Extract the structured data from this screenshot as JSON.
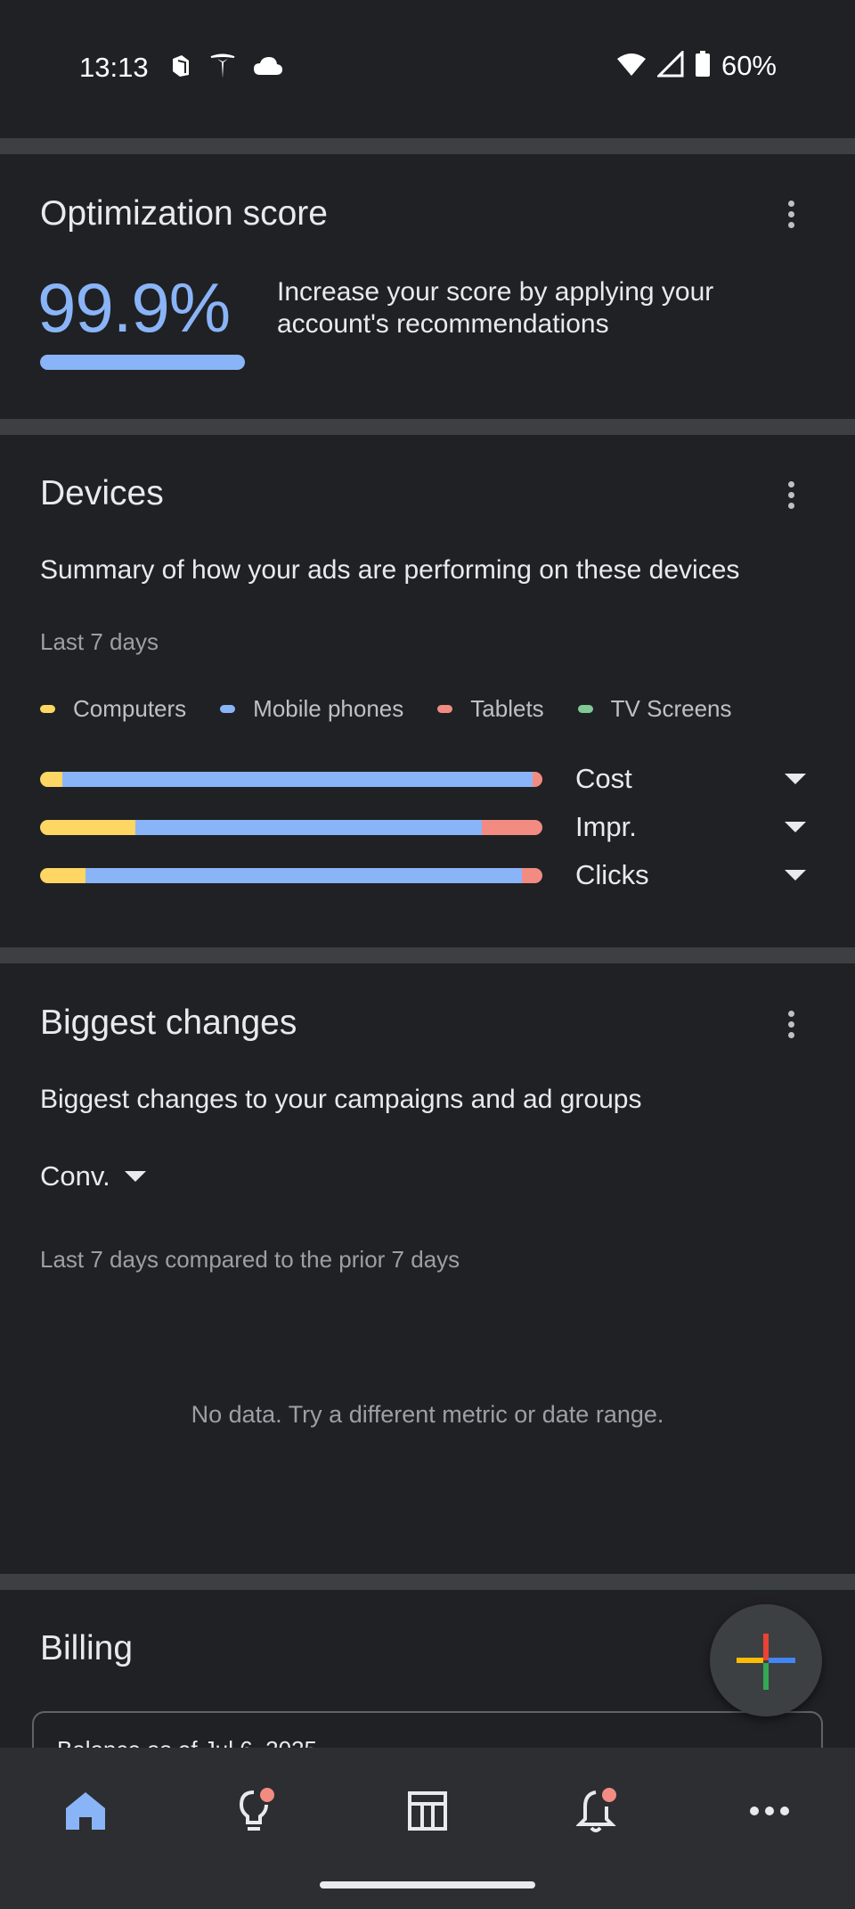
{
  "status_bar": {
    "time": "13:13",
    "battery_pct": "60%",
    "icons": [
      "notification-icon",
      "tesla-icon",
      "cloud-icon",
      "wifi-icon",
      "signal-icon",
      "battery-icon"
    ]
  },
  "optimization": {
    "title": "Optimization score",
    "score": "99.9%",
    "score_fraction": 0.999,
    "description": "Increase your score by applying your account's recommendations"
  },
  "devices": {
    "title": "Devices",
    "subtitle": "Summary of how your ads are performing on these devices",
    "period": "Last 7 days",
    "legend": [
      {
        "label": "Computers",
        "color": "#fdd663"
      },
      {
        "label": "Mobile phones",
        "color": "#8ab4f8"
      },
      {
        "label": "Tablets",
        "color": "#f28b82"
      },
      {
        "label": "TV Screens",
        "color": "#81c995"
      }
    ],
    "metrics": [
      {
        "label": "Cost",
        "shares": [
          0.045,
          0.935,
          0.02,
          0
        ]
      },
      {
        "label": "Impr.",
        "shares": [
          0.19,
          0.69,
          0.12,
          0
        ]
      },
      {
        "label": "Clicks",
        "shares": [
          0.09,
          0.87,
          0.04,
          0
        ]
      }
    ]
  },
  "biggest_changes": {
    "title": "Biggest changes",
    "subtitle": "Biggest changes to your campaigns and ad groups",
    "metric_select": "Conv.",
    "period": "Last 7 days compared to the prior 7 days",
    "empty_message": "No data. Try a different metric or date range."
  },
  "billing": {
    "title": "Billing",
    "balance_label": "Balance as of Jul 6, 2025"
  },
  "bottom_nav": {
    "items": [
      "home-icon",
      "lightbulb-icon",
      "table-icon",
      "bell-icon",
      "more-icon"
    ]
  },
  "colors": {
    "accent": "#8ab4f8",
    "badge": "#f28b82"
  }
}
